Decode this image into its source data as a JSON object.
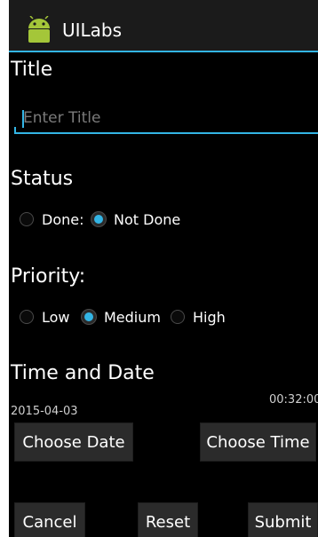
{
  "app": {
    "title": "UILabs",
    "accent_color": "#33b5e5",
    "icon": "android-icon"
  },
  "title_section": {
    "label": "Title",
    "input_value": "",
    "placeholder": "Enter Title"
  },
  "status_section": {
    "label": "Status",
    "options": [
      {
        "label": "Done:",
        "checked": false
      },
      {
        "label": "Not Done",
        "checked": true
      }
    ]
  },
  "priority_section": {
    "label": "Priority:",
    "options": [
      {
        "label": "Low",
        "checked": false
      },
      {
        "label": "Medium",
        "checked": true
      },
      {
        "label": "High",
        "checked": false
      }
    ]
  },
  "time_date_section": {
    "label": "Time and Date",
    "date_value": "2015-04-03",
    "time_value": "00:32:00",
    "choose_date_label": "Choose Date",
    "choose_time_label": "Choose Time"
  },
  "footer": {
    "cancel_label": "Cancel",
    "reset_label": "Reset",
    "submit_label": "Submit"
  }
}
